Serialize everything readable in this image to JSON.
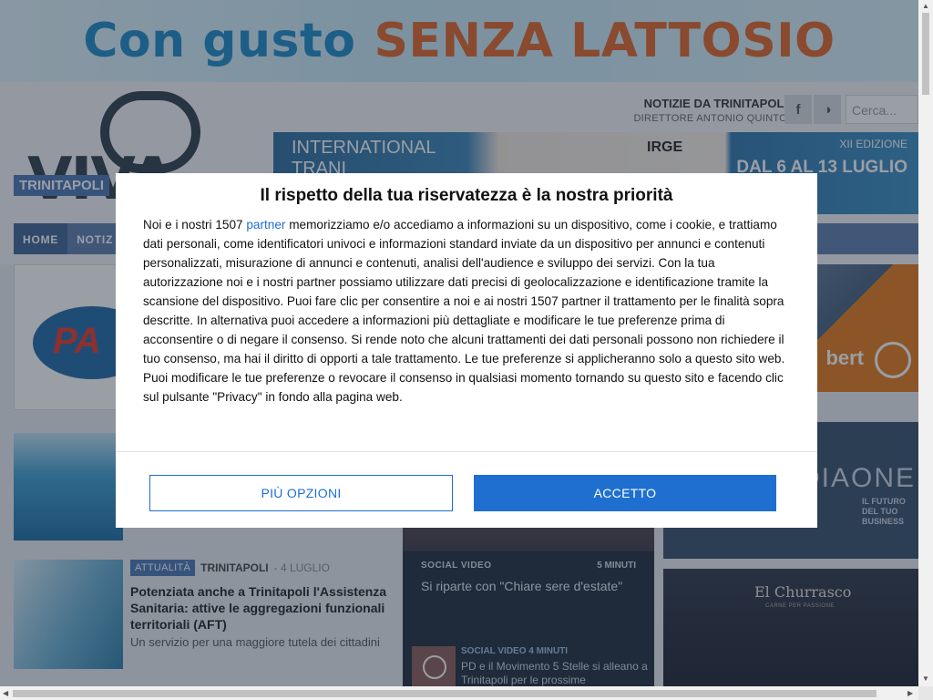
{
  "banner": {
    "text_blue": "Con gusto",
    "text_orange": "SENZA LATTOSIO"
  },
  "header": {
    "site_title": "NOTIZIE DA TRINITAPOLI",
    "director": "DIRETTORE ANTONIO QUINTO",
    "logo_text": "VIVA",
    "logo_strip": "TRINITAPOLI",
    "search_placeholder": "Cerca...",
    "facebook_icon": "f",
    "rss_icon": "◑"
  },
  "top_ad": {
    "left_text": "INTERNATIONAL\nTRANI",
    "edition": "XII EDIZIONE",
    "dates": "DAL 6 AL 13 LUGLIO",
    "brand": "IRGE"
  },
  "nav": {
    "items": [
      "HOME",
      "NOTIZ"
    ]
  },
  "article": {
    "category": "ATTUALITÀ",
    "location": "TRINITAPOLI",
    "date": "- 4 LUGLIO",
    "title": "Potenziata anche a Trinitapoli l'Assistenza Sanitaria: attive le aggregazioni funzionali territoriali (AFT)",
    "summary": "Un servizio per una maggiore tutela dei cittadini"
  },
  "video": {
    "label": "SOCIAL VIDEO",
    "duration": "5 MINUTI",
    "title": "Si riparte con \"Chiare sere d'estate\"",
    "second_label": "SOCIAL VIDEO 4 MINUTI",
    "second_title": "PD e il Movimento 5 Stelle si alleano a Trinitapoli per le prossime"
  },
  "side_ads": {
    "ad1": "bert",
    "ad2_big": "DIAONE",
    "ad2_small": "IL FUTURO\nDEL TUO BUSINESS",
    "ad2_letter": "A",
    "ad3_title": "El Churrasco",
    "ad3_sub": "CARNE PER PASSIONE"
  },
  "consent": {
    "title": "Il rispetto della tua riservatezza è la nostra priorità",
    "body_prefix": "Noi e i nostri 1507 ",
    "body_link": "partner",
    "body_rest": " memorizziamo e/o accediamo a informazioni su un dispositivo, come i cookie, e trattiamo dati personali, come identificatori univoci e informazioni standard inviate da un dispositivo per annunci e contenuti personalizzati, misurazione di annunci e contenuti, analisi dell'audience e sviluppo dei servizi. Con la tua autorizzazione noi e i nostri partner possiamo utilizzare dati precisi di geolocalizzazione e identificazione tramite la scansione del dispositivo. Puoi fare clic per consentire a noi e ai nostri 1507 partner il trattamento per le finalità sopra descritte. In alternativa puoi accedere a informazioni più dettagliate e modificare le tue preferenze prima di acconsentire o di negare il consenso. Si rende noto che alcuni trattamenti dei dati personali possono non richiedere il tuo consenso, ma hai il diritto di opporti a tale trattamento. Le tue preferenze si applicheranno solo a questo sito web. Puoi modificare le tue preferenze o revocare il consenso in qualsiasi momento tornando su questo sito e facendo clic sul pulsante \"Privacy\" in fondo alla pagina web.",
    "more_options": "PIÙ OPZIONI",
    "accept": "ACCETTO"
  },
  "colors": {
    "accent": "#1e6fd0",
    "nav": "#5c7fae",
    "badge": "#4a77b5"
  }
}
